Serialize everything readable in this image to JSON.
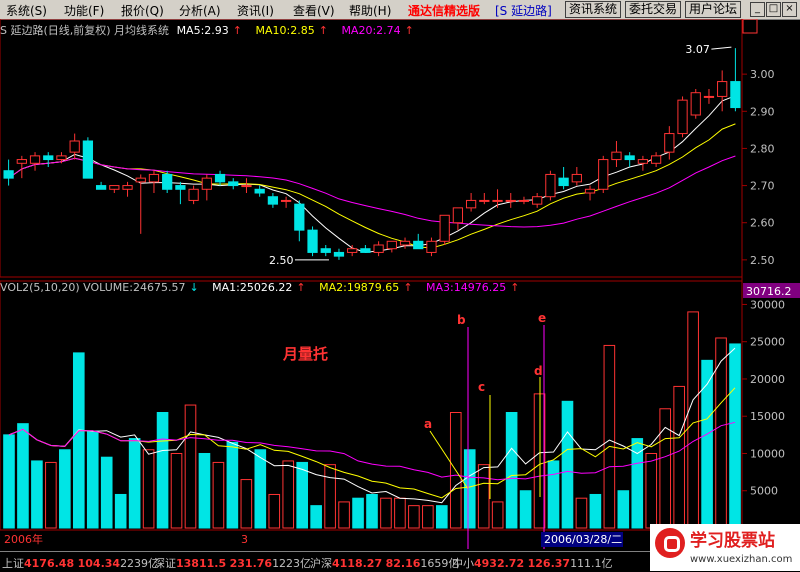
{
  "menu": [
    "系统(S)",
    "功能(F)",
    "报价(Q)",
    "分析(A)",
    "资讯(I)",
    "查看(V)",
    "帮助(H)"
  ],
  "app_title": "通达信精选版",
  "stock_label": "[S 延边路]",
  "toolbar_buttons": [
    "资讯系统",
    "委托交易",
    "用户论坛"
  ],
  "price_header": {
    "name": "S 延边路(日线,前复权) 月均线系统",
    "ma5": "MA5:2.93",
    "ma10": "MA10:2.85",
    "ma20": "MA20:2.74"
  },
  "price_axis": [
    "3.00",
    "2.90",
    "2.80",
    "2.70",
    "2.60",
    "2.50"
  ],
  "price_annotations": {
    "high": "3.07",
    "low": "2.50"
  },
  "volume_header": {
    "name": "VOL2(5,10,20) VOLUME:24675.57",
    "ma1": "MA1:25026.22",
    "ma2": "MA2:19879.65",
    "ma3": "MA3:14976.25"
  },
  "volume_axis": [
    "30000",
    "25000",
    "20000",
    "15000",
    "10000",
    "5000"
  ],
  "volume_current": "30716.2",
  "volume_title": "月量托",
  "markers": [
    "a",
    "b",
    "c",
    "d",
    "e"
  ],
  "date_labels": {
    "start": "2006年",
    "mid": "3",
    "cursor": "2006/03/28/二"
  },
  "status_bar": [
    {
      "name": "上证",
      "value": "4176.48",
      "change": "104.34",
      "amount": "2239亿"
    },
    {
      "name": "深证",
      "value": "13811.5",
      "change": "231.76",
      "amount": "1223亿"
    },
    {
      "name": "沪深",
      "value": "4118.27",
      "change": "82.16",
      "amount": "1659亿"
    },
    {
      "name": "中小",
      "value": "4932.72",
      "change": "126.37",
      "amount": "111.1亿"
    }
  ],
  "watermark": {
    "title": "学习股票站",
    "url": "www.xuexizhan.com"
  },
  "chart_data": {
    "type": "candlestick",
    "colors": {
      "up": "#ff3333",
      "down": "#00e5e5",
      "ma5": "#ffffff",
      "ma10": "#ffff00",
      "ma20": "#ff00ff"
    },
    "ohlc": [
      [
        2.74,
        2.77,
        2.7,
        2.72
      ],
      [
        2.76,
        2.78,
        2.72,
        2.77
      ],
      [
        2.76,
        2.79,
        2.74,
        2.78
      ],
      [
        2.78,
        2.79,
        2.75,
        2.77
      ],
      [
        2.77,
        2.79,
        2.76,
        2.78
      ],
      [
        2.79,
        2.84,
        2.77,
        2.82
      ],
      [
        2.82,
        2.83,
        2.72,
        2.72
      ],
      [
        2.7,
        2.71,
        2.69,
        2.69
      ],
      [
        2.69,
        2.7,
        2.68,
        2.7
      ],
      [
        2.69,
        2.71,
        2.67,
        2.7
      ],
      [
        2.71,
        2.73,
        2.57,
        2.72
      ],
      [
        2.71,
        2.74,
        2.68,
        2.73
      ],
      [
        2.73,
        2.74,
        2.68,
        2.69
      ],
      [
        2.7,
        2.71,
        2.65,
        2.69
      ],
      [
        2.66,
        2.7,
        2.65,
        2.69
      ],
      [
        2.69,
        2.73,
        2.66,
        2.72
      ],
      [
        2.73,
        2.74,
        2.7,
        2.71
      ],
      [
        2.71,
        2.72,
        2.69,
        2.7
      ],
      [
        2.7,
        2.72,
        2.68,
        2.7
      ],
      [
        2.69,
        2.7,
        2.67,
        2.68
      ],
      [
        2.67,
        2.68,
        2.64,
        2.65
      ],
      [
        2.66,
        2.67,
        2.64,
        2.66
      ],
      [
        2.65,
        2.66,
        2.55,
        2.58
      ],
      [
        2.58,
        2.59,
        2.51,
        2.52
      ],
      [
        2.53,
        2.54,
        2.51,
        2.52
      ],
      [
        2.52,
        2.53,
        2.5,
        2.51
      ],
      [
        2.52,
        2.54,
        2.51,
        2.53
      ],
      [
        2.53,
        2.54,
        2.52,
        2.52
      ],
      [
        2.52,
        2.55,
        2.51,
        2.54
      ],
      [
        2.53,
        2.55,
        2.52,
        2.55
      ],
      [
        2.54,
        2.56,
        2.53,
        2.55
      ],
      [
        2.55,
        2.57,
        2.53,
        2.53
      ],
      [
        2.52,
        2.56,
        2.51,
        2.55
      ],
      [
        2.55,
        2.62,
        2.54,
        2.62
      ],
      [
        2.6,
        2.64,
        2.58,
        2.64
      ],
      [
        2.64,
        2.68,
        2.63,
        2.66
      ],
      [
        2.66,
        2.68,
        2.65,
        2.66
      ],
      [
        2.66,
        2.69,
        2.64,
        2.66
      ],
      [
        2.66,
        2.68,
        2.64,
        2.66
      ],
      [
        2.66,
        2.67,
        2.65,
        2.66
      ],
      [
        2.65,
        2.68,
        2.64,
        2.67
      ],
      [
        2.67,
        2.74,
        2.66,
        2.73
      ],
      [
        2.72,
        2.75,
        2.69,
        2.7
      ],
      [
        2.71,
        2.75,
        2.7,
        2.73
      ],
      [
        2.68,
        2.7,
        2.66,
        2.69
      ],
      [
        2.69,
        2.78,
        2.68,
        2.77
      ],
      [
        2.77,
        2.82,
        2.75,
        2.79
      ],
      [
        2.78,
        2.79,
        2.75,
        2.77
      ],
      [
        2.76,
        2.78,
        2.74,
        2.77
      ],
      [
        2.76,
        2.79,
        2.75,
        2.78
      ],
      [
        2.79,
        2.86,
        2.77,
        2.84
      ],
      [
        2.84,
        2.94,
        2.83,
        2.93
      ],
      [
        2.89,
        2.96,
        2.88,
        2.95
      ],
      [
        2.94,
        2.96,
        2.92,
        2.94
      ],
      [
        2.94,
        3.01,
        2.9,
        2.98
      ],
      [
        2.98,
        3.07,
        2.9,
        2.91
      ]
    ],
    "volume": [
      12500,
      14000,
      9000,
      8800,
      10500,
      23500,
      13000,
      9500,
      4500,
      12000,
      10500,
      15500,
      10000,
      16500,
      10000,
      8800,
      11500,
      6500,
      10500,
      4500,
      9000,
      8800,
      3000,
      8500,
      3500,
      4000,
      4500,
      4000,
      4000,
      3000,
      3000,
      3000,
      15500,
      10500,
      8500,
      3500,
      15500,
      5000,
      18000,
      9000,
      17000,
      4000,
      4500,
      24500,
      5000,
      12000,
      10000,
      16000,
      19000,
      29000,
      22500,
      25500,
      24700
    ],
    "vol_up": [
      false,
      false,
      false,
      true,
      false,
      false,
      false,
      false,
      false,
      false,
      true,
      false,
      true,
      true,
      false,
      true,
      false,
      true,
      false,
      true,
      true,
      false,
      false,
      true,
      true,
      false,
      false,
      true,
      true,
      true,
      true,
      false,
      true,
      false,
      true,
      true,
      false,
      false,
      true,
      false,
      false,
      true,
      false,
      true,
      false,
      false,
      true,
      true,
      true,
      true,
      false,
      true,
      false
    ],
    "ylim_price": [
      2.47,
      3.1
    ],
    "ylim_volume": [
      0,
      31000
    ]
  }
}
